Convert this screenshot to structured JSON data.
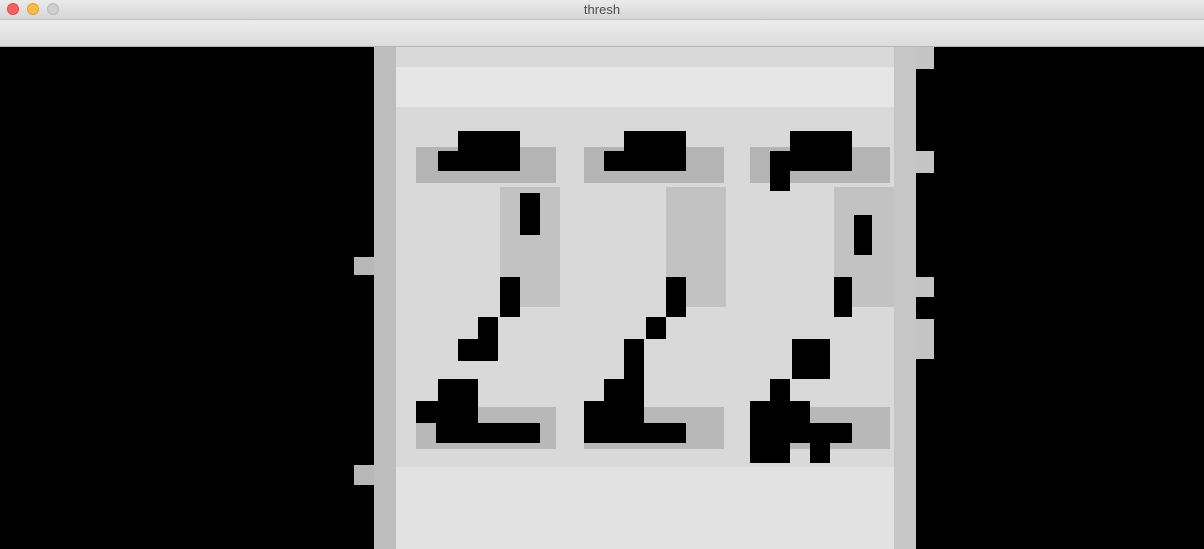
{
  "window": {
    "title": "thresh",
    "buttons": {
      "close": "close",
      "minimize": "minimize",
      "zoom": "zoom"
    }
  },
  "image": {
    "description_icon": "thresholded-image",
    "colors": {
      "background": "#000000",
      "light": "#e8e8e8",
      "mid": "#bcbcbc",
      "dark": "#000000"
    }
  }
}
